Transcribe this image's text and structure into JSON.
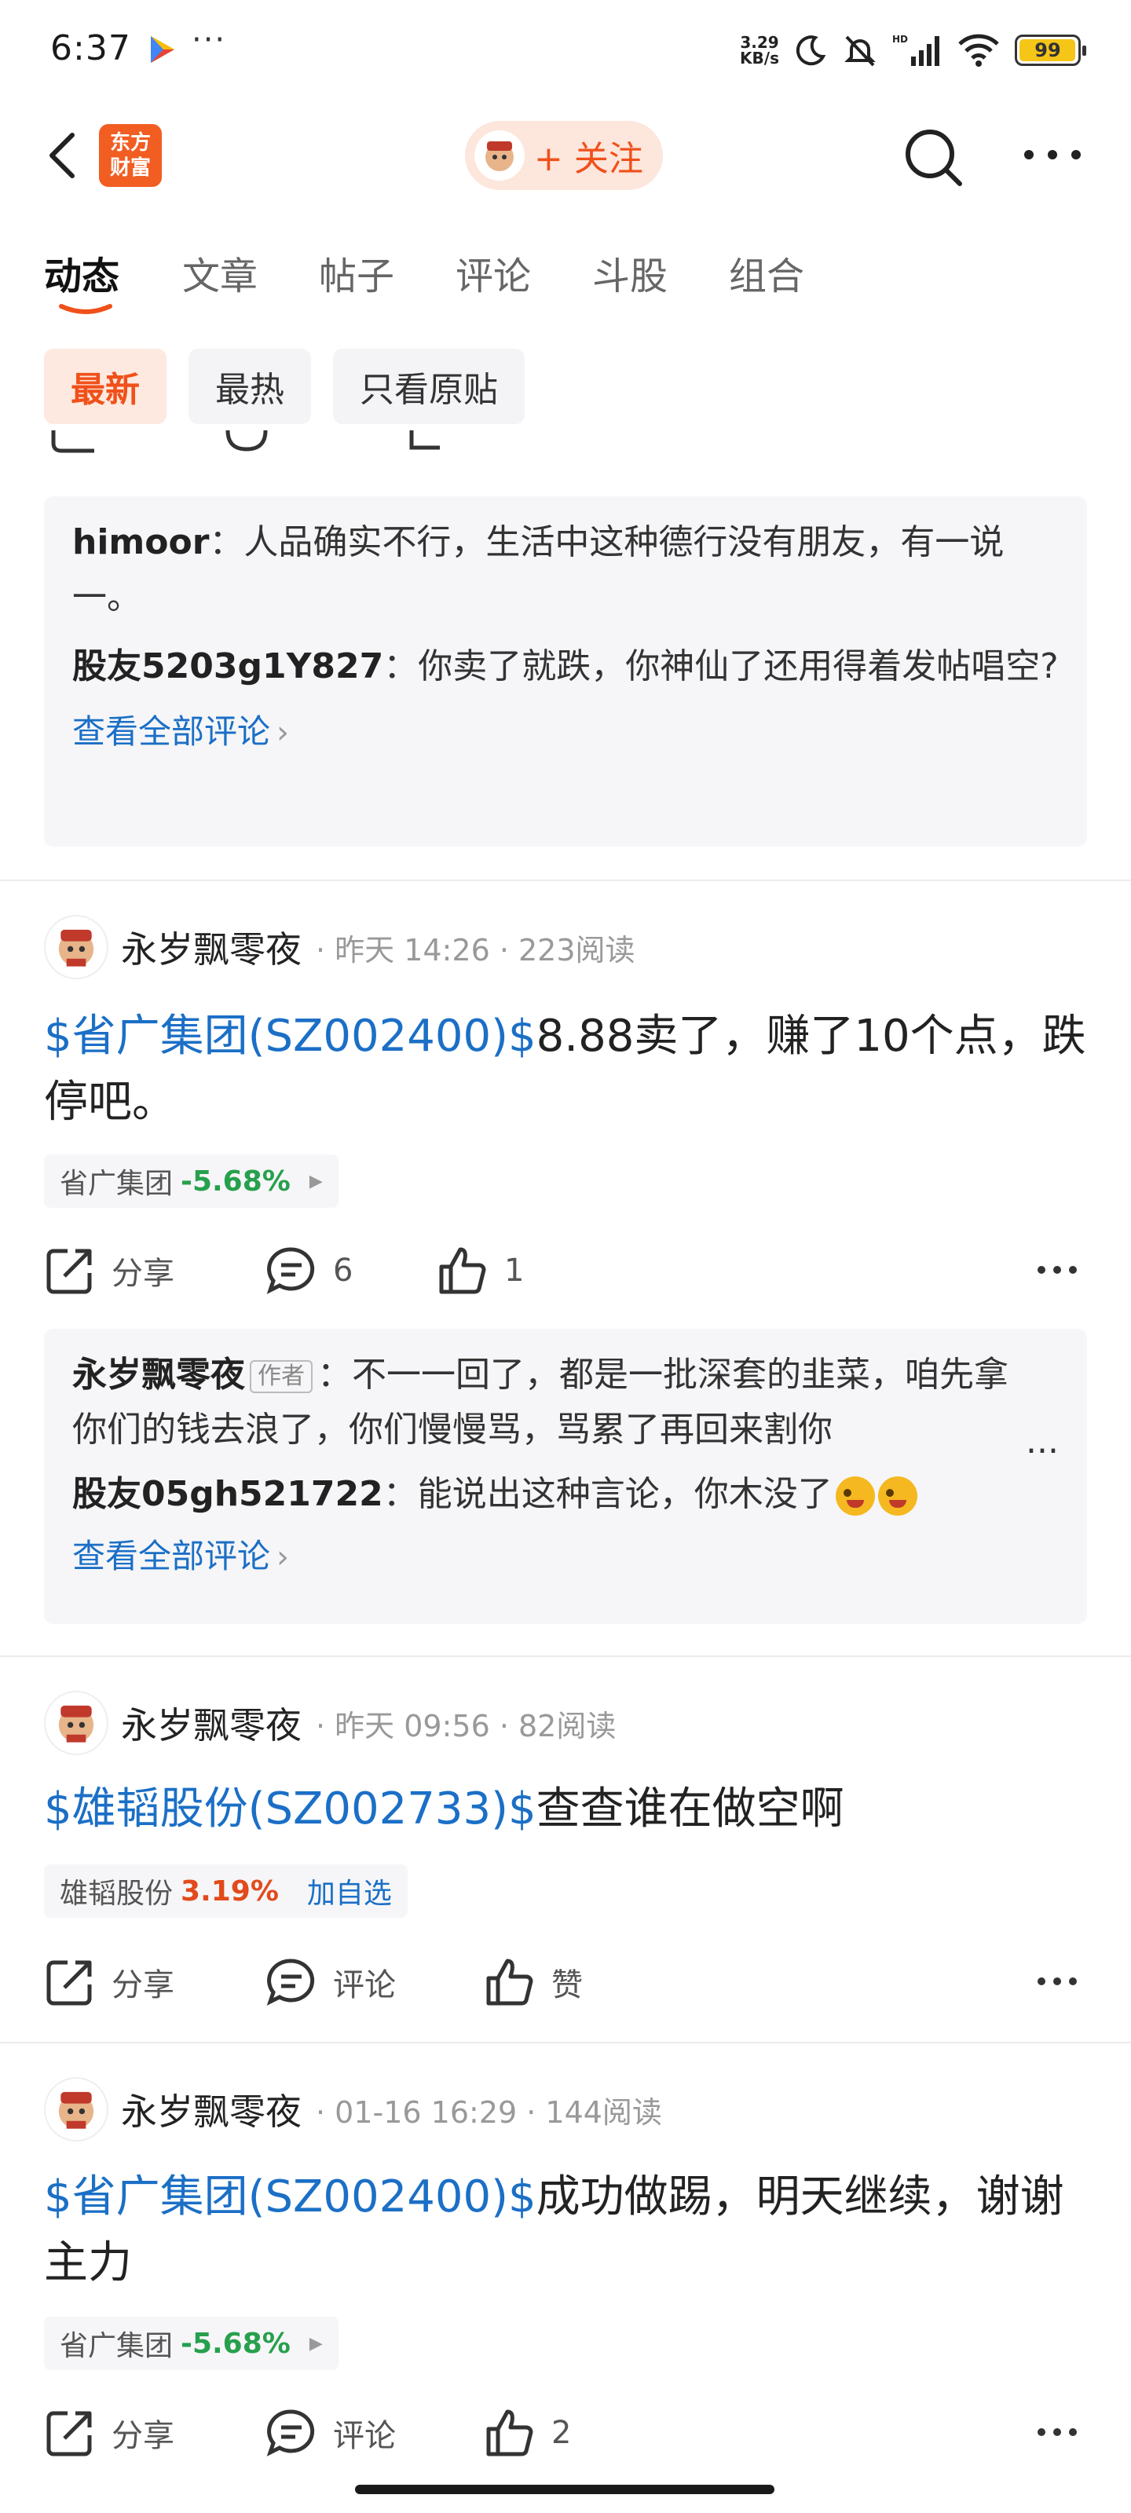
{
  "status": {
    "time": "6:37",
    "dots": "···",
    "speed_value": "3.29",
    "speed_unit": "KB/s",
    "battery": "99"
  },
  "nav": {
    "logo_line1": "东方",
    "logo_line2": "财富",
    "follow_label": "+ 关注"
  },
  "tabs": [
    "动态",
    "文章",
    "帖子",
    "评论",
    "斗股",
    "组合"
  ],
  "filters": [
    "最新",
    "最热",
    "只看原贴"
  ],
  "comments_block_1": {
    "comments": [
      {
        "name": "himoor",
        "text": "：人品确实不行，生活中这种德行没有朋友，有一说一。"
      },
      {
        "name": "股友5203g1Y827",
        "text": "：你卖了就跌，你神仙了还用得着发帖唱空?"
      }
    ],
    "see_all": "查看全部评论"
  },
  "posts": [
    {
      "user": "永岁飘零夜",
      "meta": "· 昨天 14:26 · 223阅读",
      "stock_link": "$省广集团(SZ002400)$",
      "text": "8.88卖了，赚了10个点，跌停吧。",
      "tag_name": "省广集团",
      "tag_pct": "-5.68%",
      "share": "分享",
      "comment_count": "6",
      "like_count": "1"
    },
    {
      "user": "永岁飘零夜",
      "meta": "· 昨天 09:56 · 82阅读",
      "stock_link": "$雄韬股份(SZ002733)$",
      "text": "查查谁在做空啊",
      "tag_name": "雄韬股份",
      "tag_pct": "3.19%",
      "tag_add": "加自选",
      "share": "分享",
      "comment_label": "评论",
      "like_label": "赞"
    },
    {
      "user": "永岁飘零夜",
      "meta": "· 01-16 16:29 · 144阅读",
      "stock_link": "$省广集团(SZ002400)$",
      "text": "成功做踢，明天继续，谢谢主力",
      "tag_name": "省广集团",
      "tag_pct": "-5.68%",
      "share": "分享",
      "comment_label": "评论",
      "like_count": "2"
    }
  ],
  "comments_block_2": {
    "comments": [
      {
        "name": "永岁飘零夜",
        "badge": "作者",
        "text": "：不一一回了，都是一批深套的韭菜，咱先拿你们的钱去浪了，你们慢慢骂，骂累了再回来割你"
      },
      {
        "name": "股友05gh521722",
        "text": "：能说出这种言论，你木没了"
      }
    ],
    "ellipsis": "...",
    "see_all": "查看全部评论"
  },
  "colors": {
    "accent": "#f0501a",
    "link": "#1b6fc6",
    "down": "#27a04d",
    "up": "#e24a1c"
  }
}
